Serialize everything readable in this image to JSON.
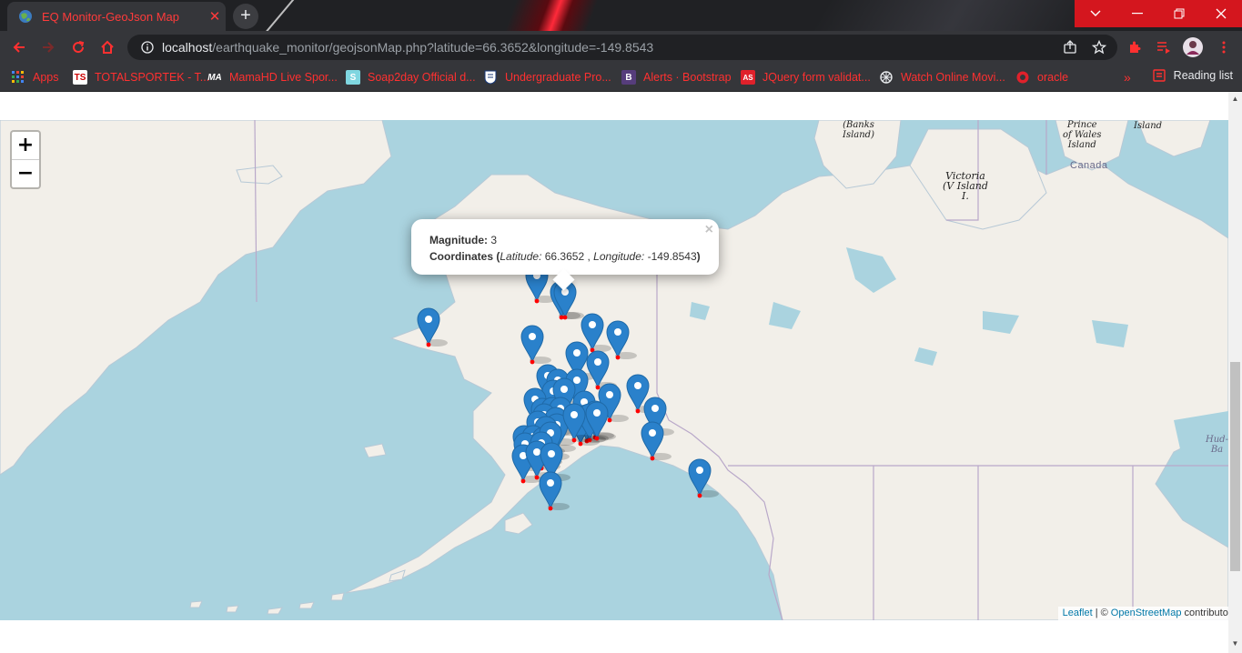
{
  "browser": {
    "tab_title": "EQ Monitor-GeoJson Map",
    "tab_close": "✕",
    "newtab": "+",
    "url_host": "localhost",
    "url_path": "/earthquake_monitor/geojsonMap.php?latitude=66.3652&longitude=-149.8543",
    "bookmarks": [
      {
        "label": "Apps",
        "icon": "apps-grid-icon"
      },
      {
        "label": "TOTALSPORTEK - T...",
        "icon": "ts-icon",
        "icon_text": "TS"
      },
      {
        "label": "MamaHD Live Spor...",
        "icon": "ma-icon",
        "icon_text": "MA"
      },
      {
        "label": "Soap2day Official d...",
        "icon": "s-icon",
        "icon_text": "S"
      },
      {
        "label": "Undergraduate Pro...",
        "icon": "shield-icon"
      },
      {
        "label": "Alerts · Bootstrap",
        "icon": "bootstrap-icon",
        "icon_text": "B"
      },
      {
        "label": "JQuery form validat...",
        "icon": "as-icon",
        "icon_text": "AS"
      },
      {
        "label": "Watch Online Movi...",
        "icon": "film-icon"
      },
      {
        "label": "oracle",
        "icon": "globe-icon"
      }
    ],
    "overflow": "»",
    "reading_list": "Reading list",
    "accent_color": "#ff3030"
  },
  "map": {
    "zoom_in": "+",
    "zoom_out": "−",
    "popup": {
      "magnitude_label": "Magnitude:",
      "magnitude_value": "3",
      "coords_label": "Coordinates",
      "open_paren": "(",
      "lat_label": "Latitude:",
      "lat_value": "66.3652",
      "sep": ",",
      "lng_label": "Longitude:",
      "lng_value": "-149.8543",
      "close_paren": ")",
      "close": "×"
    },
    "attribution": {
      "leaflet": "Leaflet",
      "sep": "| ©",
      "osm": "OpenStreetMap",
      "contributors": "contributors"
    },
    "labels": {
      "banks": "(Banks\nIsland)",
      "prince": "Prince\nof Wales\nIsland",
      "island": "Island",
      "canada": "Canada",
      "victoria": "Victoria\n(V Island\nI.",
      "hudson": "Hud-\nBa"
    },
    "marker_color": "#2a81cb",
    "point_color": "#ff0000"
  }
}
